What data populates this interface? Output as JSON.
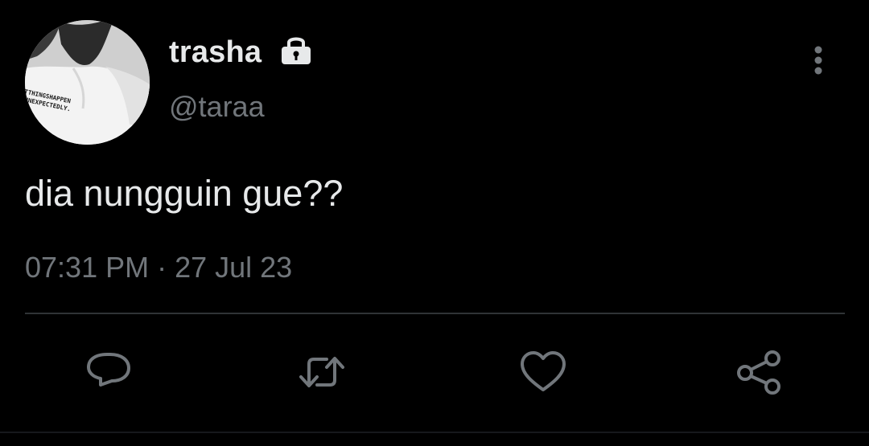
{
  "user": {
    "display_name": "trasha",
    "handle": "@taraa",
    "protected_icon": "lock-icon",
    "avatar_shirt_text_line1": "TTHINGSHAPPEN",
    "avatar_shirt_text_line2": "UNEXPECTEDLY."
  },
  "tweet": {
    "text": "dia nungguin gue??",
    "time": "07:31 PM",
    "separator": "·",
    "date": "27 Jul 23"
  },
  "actions": [
    {
      "name": "reply",
      "icon": "reply-icon"
    },
    {
      "name": "retweet",
      "icon": "retweet-icon"
    },
    {
      "name": "like",
      "icon": "heart-icon"
    },
    {
      "name": "share",
      "icon": "share-icon"
    }
  ],
  "menu_icon": "more-vertical-icon",
  "colors": {
    "background": "#000000",
    "primary_text": "#e7e9ea",
    "secondary_text": "#71767b",
    "divider": "#2f3336",
    "icon": "#71767b"
  }
}
